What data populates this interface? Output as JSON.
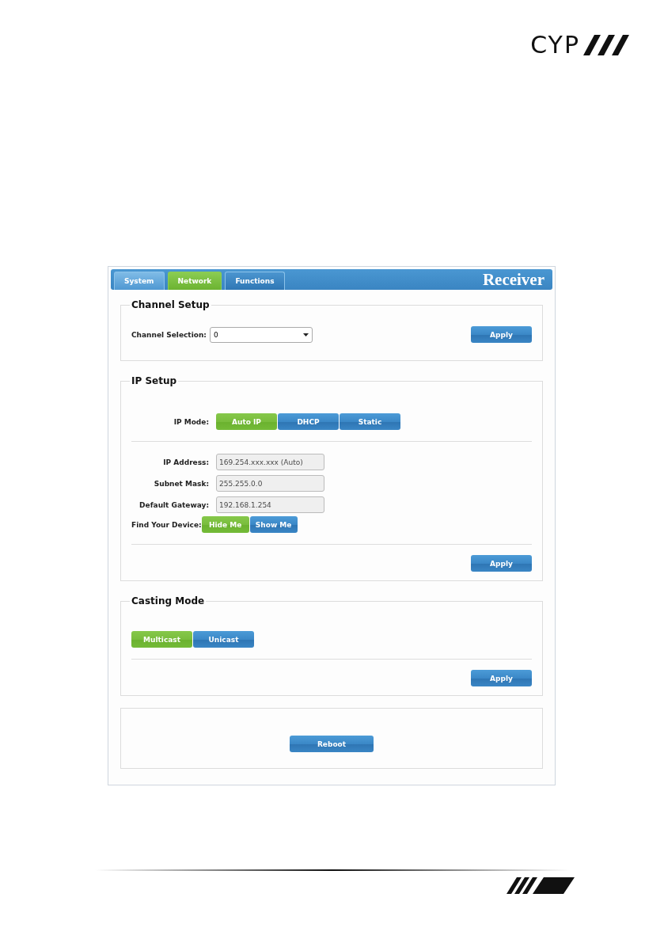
{
  "logo": {
    "text": "CYP"
  },
  "tabs": [
    {
      "label": "System",
      "selected": false,
      "kind": "faded"
    },
    {
      "label": "Network",
      "selected": true,
      "kind": "normal"
    },
    {
      "label": "Functions",
      "selected": false,
      "kind": "normal"
    }
  ],
  "header_title": "Receiver",
  "channel_setup": {
    "title": "Channel Setup",
    "label": "Channel Selection:",
    "value": "0",
    "apply": "Apply"
  },
  "ip_setup": {
    "title": "IP Setup",
    "mode_label": "IP Mode:",
    "modes": [
      {
        "label": "Auto IP",
        "selected": true
      },
      {
        "label": "DHCP",
        "selected": false
      },
      {
        "label": "Static",
        "selected": false
      }
    ],
    "fields": [
      {
        "label": "IP Address:",
        "value": "169.254.xxx.xxx (Auto)"
      },
      {
        "label": "Subnet Mask:",
        "value": "255.255.0.0"
      },
      {
        "label": "Default Gateway:",
        "value": "192.168.1.254"
      }
    ],
    "find_label": "Find Your Device:",
    "find_options": [
      {
        "label": "Hide Me",
        "selected": true
      },
      {
        "label": "Show Me",
        "selected": false
      }
    ],
    "apply": "Apply"
  },
  "casting_mode": {
    "title": "Casting Mode",
    "options": [
      {
        "label": "Multicast",
        "selected": true
      },
      {
        "label": "Unicast",
        "selected": false
      }
    ],
    "apply": "Apply"
  },
  "reboot": "Reboot"
}
